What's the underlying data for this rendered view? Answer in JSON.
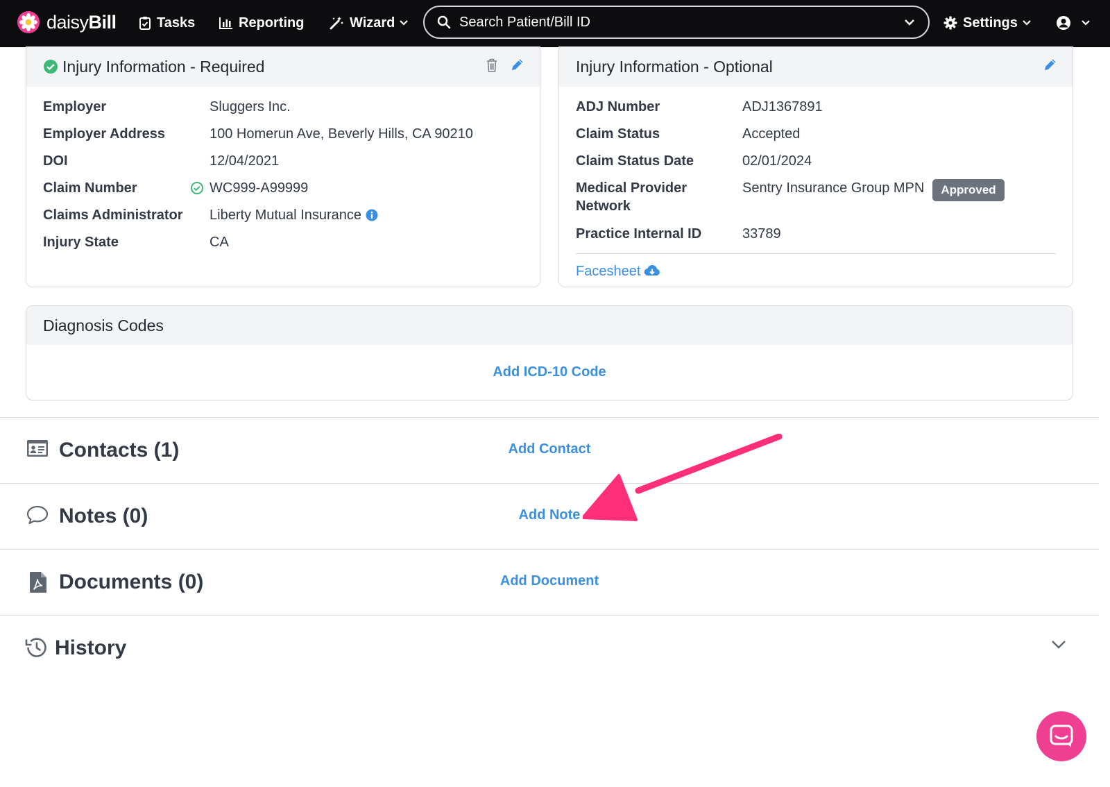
{
  "colors": {
    "navbar": "#0d0d0f",
    "link": "#3b8fe0",
    "success": "#3cb878",
    "badge": "#6c737d",
    "accent": "#ee3f93"
  },
  "navbar": {
    "brand_prefix": "daisy",
    "brand_suffix": "Bill",
    "tasks": "Tasks",
    "reporting": "Reporting",
    "wizard": "Wizard",
    "search_placeholder": "Search Patient/Bill ID",
    "settings": "Settings"
  },
  "injury_required": {
    "title": "Injury Information - Required",
    "rows": [
      {
        "label": "Employer",
        "value": "Sluggers Inc."
      },
      {
        "label": "Employer Address",
        "value": "100 Homerun Ave, Beverly Hills, CA 90210"
      },
      {
        "label": "DOI",
        "value": "12/04/2021"
      },
      {
        "label": "Claim Number",
        "value": "WC999-A99999"
      },
      {
        "label": "Claims Administrator",
        "value": "Liberty Mutual Insurance"
      },
      {
        "label": "Injury State",
        "value": "CA"
      }
    ]
  },
  "injury_optional": {
    "title": "Injury Information - Optional",
    "rows": [
      {
        "label": "ADJ Number",
        "value": "ADJ1367891"
      },
      {
        "label": "Claim Status",
        "value": "Accepted"
      },
      {
        "label": "Claim Status Date",
        "value": "02/01/2024"
      },
      {
        "label": "Medical Provider Network",
        "value": "Sentry Insurance Group MPN",
        "badge": "Approved"
      },
      {
        "label": "Practice Internal ID",
        "value": "33789"
      }
    ],
    "facesheet": "Facesheet"
  },
  "diagnosis": {
    "title": "Diagnosis Codes",
    "action": "Add ICD-10 Code"
  },
  "sections": {
    "contacts": {
      "title": "Contacts (1)",
      "action": "Add Contact"
    },
    "notes": {
      "title": "Notes (0)",
      "action": "Add Note"
    },
    "documents": {
      "title": "Documents (0)",
      "action": "Add Document"
    },
    "history": {
      "title": "History"
    }
  }
}
